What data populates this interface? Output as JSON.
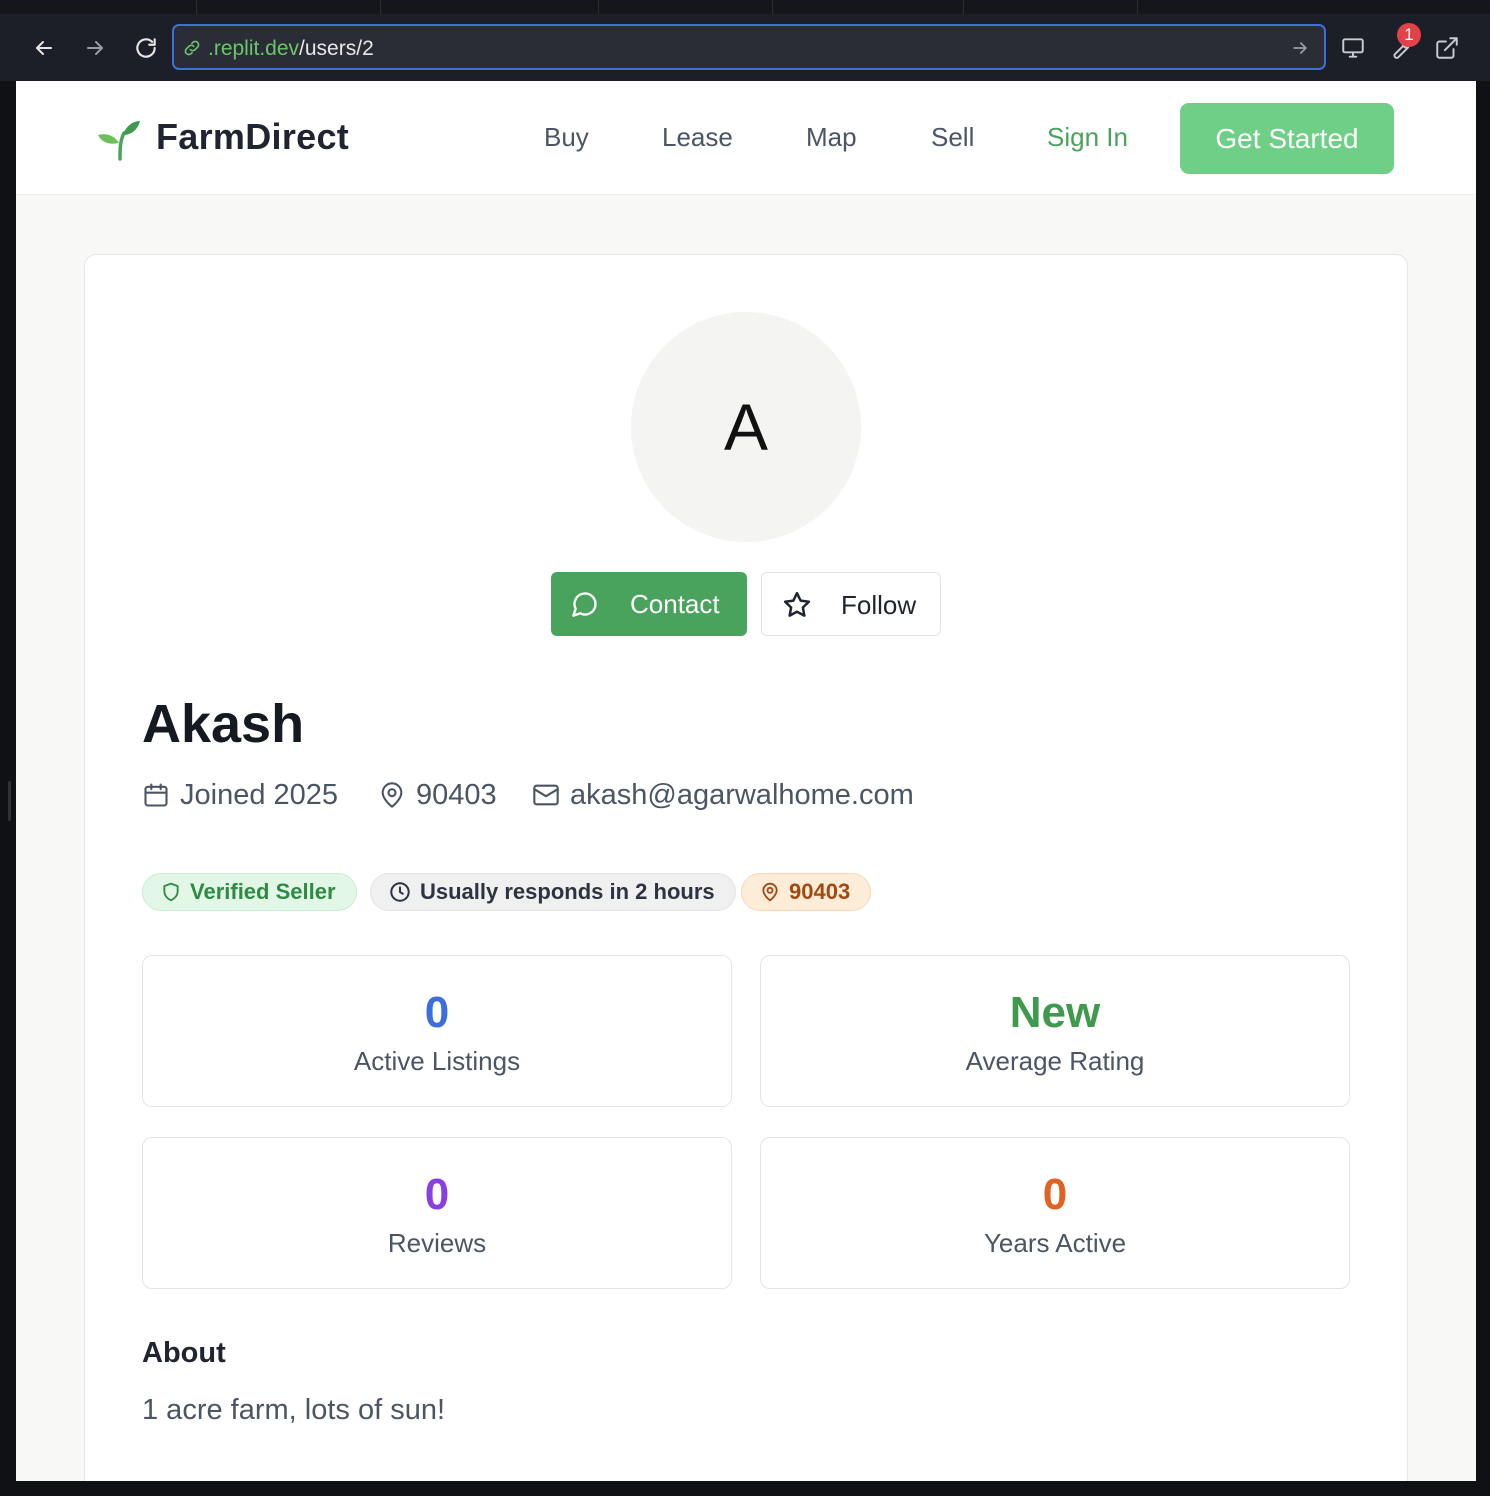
{
  "browser": {
    "url_domain": ".replit.dev",
    "url_path": "/users/2",
    "notification_count": "1",
    "accent_color": "#3f6fd8"
  },
  "nav": {
    "brand": "FarmDirect",
    "links": [
      "Buy",
      "Lease",
      "Map",
      "Sell"
    ],
    "sign_in": "Sign In",
    "cta": "Get Started",
    "brand_color": "#6fcf87"
  },
  "profile": {
    "avatar_initial": "A",
    "contact_label": "Contact",
    "follow_label": "Follow",
    "name": "Akash",
    "joined": "Joined 2025",
    "zip": "90403",
    "email": "akash@agarwalhome.com",
    "badges": {
      "verified": "Verified Seller",
      "response": "Usually responds in 2 hours",
      "location": "90403"
    },
    "stats": [
      {
        "value": "0",
        "label": "Active Listings",
        "color": "#3b6fe0"
      },
      {
        "value": "New",
        "label": "Average Rating",
        "color": "#3f9a4f"
      },
      {
        "value": "0",
        "label": "Reviews",
        "color": "#8a3fe0"
      },
      {
        "value": "0",
        "label": "Years Active",
        "color": "#e0631f"
      }
    ],
    "about_heading": "About",
    "about_text": "1 acre farm, lots of sun!"
  }
}
